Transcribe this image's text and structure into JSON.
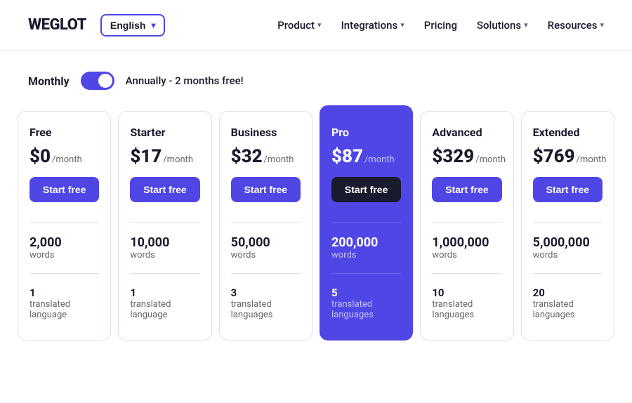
{
  "header": {
    "logo_text": "WEGLOT",
    "lang_button": "English",
    "nav_items": [
      {
        "label": "Product",
        "has_dropdown": true
      },
      {
        "label": "Integrations",
        "has_dropdown": true
      },
      {
        "label": "Pricing",
        "has_dropdown": false
      },
      {
        "label": "Solutions",
        "has_dropdown": true
      },
      {
        "label": "Resources",
        "has_dropdown": true
      }
    ]
  },
  "billing": {
    "monthly_label": "Monthly",
    "annual_label": "Annually - 2 months free!"
  },
  "plans": [
    {
      "id": "free",
      "name": "Free",
      "price": "$0",
      "period": "/month",
      "btn_label": "Start free",
      "words": "2,000",
      "words_label": "words",
      "translated_count": "1",
      "translated_label": "translated language",
      "is_pro": false
    },
    {
      "id": "starter",
      "name": "Starter",
      "price": "$17",
      "period": "/month",
      "btn_label": "Start free",
      "words": "10,000",
      "words_label": "words",
      "translated_count": "1",
      "translated_label": "translated language",
      "is_pro": false
    },
    {
      "id": "business",
      "name": "Business",
      "price": "$32",
      "period": "/month",
      "btn_label": "Start free",
      "words": "50,000",
      "words_label": "words",
      "translated_count": "3",
      "translated_label": "translated languages",
      "is_pro": false
    },
    {
      "id": "pro",
      "name": "Pro",
      "price": "$87",
      "period": "/month",
      "btn_label": "Start free",
      "words": "200,000",
      "words_label": "words",
      "translated_count": "5",
      "translated_label": "translated languages",
      "is_pro": true
    },
    {
      "id": "advanced",
      "name": "Advanced",
      "price": "$329",
      "period": "/month",
      "btn_label": "Start free",
      "words": "1,000,000",
      "words_label": "words",
      "translated_count": "10",
      "translated_label": "translated languages",
      "is_pro": false
    },
    {
      "id": "extended",
      "name": "Extended",
      "price": "$769",
      "period": "/month",
      "btn_label": "Start free",
      "words": "5,000,000",
      "words_label": "words",
      "translated_count": "20",
      "translated_label": "translated languages",
      "is_pro": false
    }
  ]
}
